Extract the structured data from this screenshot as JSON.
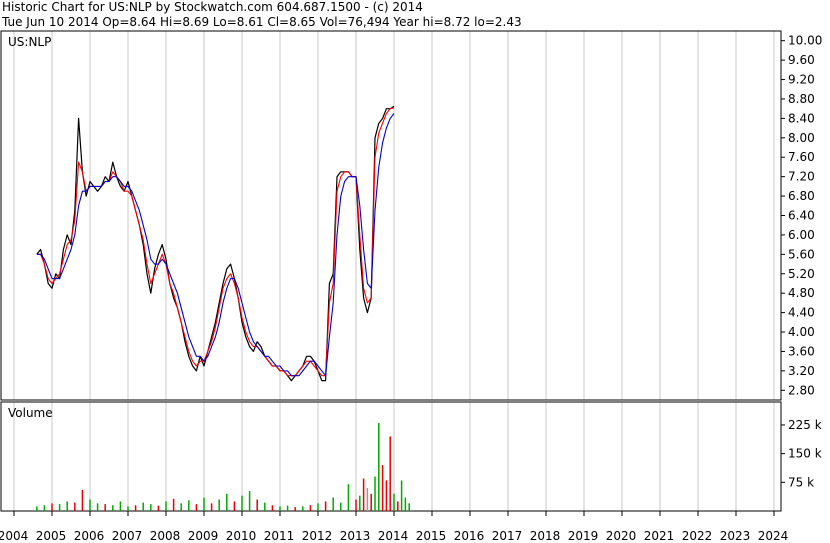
{
  "header": {
    "line1": "Historic Chart for US:NLP by Stockwatch.com 604.687.1500 - (c) 2014",
    "line2": "Tue Jun 10 2014  Op=8.64  Hi=8.69  Lo=8.61  Cl=8.65  Vol=76,494  Year hi=8.72  lo=2.43"
  },
  "chart_data": [
    {
      "type": "line",
      "panel": "price",
      "label": "US:NLP",
      "ylim": [
        2.6,
        10.2
      ],
      "y_ticks": [
        "10.00",
        "9.60",
        "9.20",
        "8.80",
        "8.40",
        "8.00",
        "7.60",
        "7.20",
        "6.80",
        "6.40",
        "6.00",
        "5.60",
        "5.20",
        "4.80",
        "4.40",
        "4.00",
        "3.60",
        "3.20",
        "2.80"
      ],
      "x": [
        2004.6,
        2004.7,
        2004.8,
        2004.9,
        2005.0,
        2005.1,
        2005.2,
        2005.3,
        2005.4,
        2005.5,
        2005.6,
        2005.7,
        2005.8,
        2005.9,
        2006.0,
        2006.1,
        2006.2,
        2006.3,
        2006.4,
        2006.5,
        2006.6,
        2006.7,
        2006.8,
        2006.9,
        2007.0,
        2007.1,
        2007.2,
        2007.3,
        2007.4,
        2007.5,
        2007.6,
        2007.7,
        2007.8,
        2007.9,
        2008.0,
        2008.1,
        2008.2,
        2008.3,
        2008.4,
        2008.5,
        2008.6,
        2008.7,
        2008.8,
        2008.9,
        2009.0,
        2009.1,
        2009.2,
        2009.3,
        2009.4,
        2009.5,
        2009.6,
        2009.7,
        2009.8,
        2009.9,
        2010.0,
        2010.1,
        2010.2,
        2010.3,
        2010.4,
        2010.5,
        2010.6,
        2010.7,
        2010.8,
        2010.9,
        2011.0,
        2011.1,
        2011.2,
        2011.3,
        2011.4,
        2011.5,
        2011.6,
        2011.7,
        2011.8,
        2011.9,
        2012.0,
        2012.1,
        2012.2,
        2012.3,
        2012.4,
        2012.5,
        2012.6,
        2012.7,
        2012.8,
        2012.9,
        2013.0,
        2013.1,
        2013.2,
        2013.3,
        2013.4,
        2013.5,
        2013.6,
        2013.7,
        2013.8,
        2013.9,
        2014.0,
        2014.1,
        2014.2,
        2014.3,
        2014.4
      ],
      "series": [
        {
          "color": "#000000",
          "values": [
            5.6,
            5.7,
            5.4,
            5.0,
            4.9,
            5.2,
            5.1,
            5.7,
            6.0,
            5.8,
            6.5,
            8.4,
            7.3,
            6.8,
            7.1,
            7.0,
            6.9,
            7.0,
            7.2,
            7.1,
            7.5,
            7.2,
            7.0,
            6.9,
            7.1,
            6.8,
            6.5,
            6.2,
            5.8,
            5.2,
            4.8,
            5.3,
            5.6,
            5.8,
            5.5,
            5.0,
            4.7,
            4.5,
            4.2,
            3.8,
            3.5,
            3.3,
            3.2,
            3.5,
            3.3,
            3.6,
            3.9,
            4.2,
            4.6,
            5.0,
            5.3,
            5.4,
            5.1,
            4.7,
            4.2,
            3.9,
            3.7,
            3.6,
            3.8,
            3.7,
            3.5,
            3.4,
            3.3,
            3.3,
            3.2,
            3.2,
            3.1,
            3.0,
            3.1,
            3.2,
            3.3,
            3.5,
            3.5,
            3.4,
            3.2,
            3.0,
            3.0,
            5.0,
            5.2,
            7.2,
            7.3,
            7.3,
            7.3,
            7.2,
            7.2,
            5.7,
            4.7,
            4.4,
            4.7,
            8.0,
            8.3,
            8.4,
            8.6,
            8.6,
            8.65
          ]
        },
        {
          "color": "#ff0000",
          "values": [
            5.6,
            5.6,
            5.4,
            5.1,
            5.0,
            5.1,
            5.2,
            5.5,
            5.8,
            5.9,
            6.3,
            7.5,
            7.3,
            6.9,
            7.0,
            7.0,
            7.0,
            7.0,
            7.1,
            7.1,
            7.3,
            7.2,
            7.1,
            6.9,
            6.9,
            6.8,
            6.5,
            6.2,
            5.9,
            5.4,
            5.0,
            5.2,
            5.4,
            5.6,
            5.4,
            5.0,
            4.8,
            4.5,
            4.2,
            3.9,
            3.6,
            3.4,
            3.3,
            3.4,
            3.4,
            3.6,
            3.8,
            4.1,
            4.5,
            4.9,
            5.1,
            5.2,
            5.0,
            4.7,
            4.3,
            4.0,
            3.8,
            3.7,
            3.7,
            3.6,
            3.5,
            3.4,
            3.3,
            3.3,
            3.2,
            3.2,
            3.1,
            3.1,
            3.1,
            3.2,
            3.3,
            3.4,
            3.4,
            3.3,
            3.2,
            3.1,
            3.1,
            4.6,
            5.0,
            6.9,
            7.2,
            7.3,
            7.3,
            7.2,
            7.2,
            6.0,
            4.9,
            4.6,
            4.7,
            7.6,
            8.1,
            8.3,
            8.5,
            8.6,
            8.62
          ]
        },
        {
          "color": "#0000cc",
          "values": [
            5.6,
            5.6,
            5.5,
            5.3,
            5.1,
            5.1,
            5.1,
            5.3,
            5.5,
            5.7,
            6.0,
            6.6,
            6.9,
            6.9,
            7.0,
            7.0,
            7.0,
            7.0,
            7.1,
            7.1,
            7.2,
            7.2,
            7.1,
            7.0,
            7.0,
            6.9,
            6.7,
            6.5,
            6.2,
            5.9,
            5.5,
            5.4,
            5.4,
            5.5,
            5.4,
            5.2,
            5.0,
            4.8,
            4.5,
            4.2,
            3.9,
            3.7,
            3.5,
            3.5,
            3.4,
            3.5,
            3.7,
            3.9,
            4.2,
            4.6,
            4.9,
            5.1,
            5.1,
            4.9,
            4.6,
            4.3,
            4.0,
            3.8,
            3.7,
            3.6,
            3.5,
            3.5,
            3.4,
            3.3,
            3.3,
            3.2,
            3.2,
            3.1,
            3.1,
            3.1,
            3.2,
            3.3,
            3.4,
            3.4,
            3.3,
            3.2,
            3.1,
            3.9,
            4.6,
            6.0,
            6.8,
            7.1,
            7.2,
            7.2,
            7.2,
            6.6,
            5.7,
            5.0,
            4.9,
            6.5,
            7.4,
            7.9,
            8.2,
            8.4,
            8.5
          ]
        }
      ]
    },
    {
      "type": "bar",
      "panel": "volume",
      "label": "Volume",
      "ylim": [
        0,
        285000
      ],
      "y_ticks": [
        "225 k",
        "150 k",
        "75 k"
      ],
      "x_tick_labels": [
        "2004",
        "2005",
        "2006",
        "2007",
        "2008",
        "2009",
        "2010",
        "2011",
        "2012",
        "2013",
        "2014",
        "2015",
        "2016",
        "2017",
        "2018",
        "2019",
        "2020",
        "2021",
        "2022",
        "2023",
        "2024"
      ],
      "x": [
        2004.6,
        2004.8,
        2005.0,
        2005.2,
        2005.4,
        2005.6,
        2005.8,
        2006.0,
        2006.2,
        2006.4,
        2006.6,
        2006.8,
        2007.0,
        2007.2,
        2007.4,
        2007.6,
        2007.8,
        2008.0,
        2008.2,
        2008.4,
        2008.6,
        2008.8,
        2009.0,
        2009.2,
        2009.4,
        2009.6,
        2009.8,
        2010.0,
        2010.2,
        2010.4,
        2010.6,
        2010.8,
        2011.0,
        2011.2,
        2011.4,
        2011.6,
        2011.8,
        2012.0,
        2012.2,
        2012.4,
        2012.6,
        2012.8,
        2013.0,
        2013.1,
        2013.2,
        2013.3,
        2013.4,
        2013.5,
        2013.6,
        2013.7,
        2013.8,
        2013.9,
        2014.0,
        2014.1,
        2014.2,
        2014.3,
        2014.4
      ],
      "values": [
        12000,
        15000,
        20000,
        18000,
        25000,
        22000,
        55000,
        30000,
        20000,
        18000,
        15000,
        25000,
        12000,
        15000,
        22000,
        18000,
        14000,
        25000,
        32000,
        20000,
        28000,
        18000,
        35000,
        20000,
        30000,
        45000,
        25000,
        40000,
        52000,
        30000,
        22000,
        15000,
        12000,
        14000,
        10000,
        12000,
        15000,
        20000,
        25000,
        35000,
        22000,
        70000,
        30000,
        40000,
        85000,
        60000,
        45000,
        90000,
        230000,
        120000,
        80000,
        195000,
        45000,
        25000,
        80000,
        35000,
        20000
      ],
      "colors": [
        "green",
        "green",
        "red",
        "green",
        "green",
        "red",
        "red",
        "green",
        "green",
        "red",
        "green",
        "green",
        "green",
        "red",
        "green",
        "green",
        "red",
        "green",
        "red",
        "green",
        "green",
        "red",
        "green",
        "red",
        "green",
        "green",
        "red",
        "green",
        "green",
        "red",
        "green",
        "red",
        "green",
        "green",
        "red",
        "green",
        "red",
        "green",
        "red",
        "green",
        "green",
        "green",
        "red",
        "green",
        "red",
        "gray",
        "red",
        "green",
        "green",
        "red",
        "red",
        "red",
        "green",
        "red",
        "green",
        "green",
        "green"
      ]
    }
  ]
}
